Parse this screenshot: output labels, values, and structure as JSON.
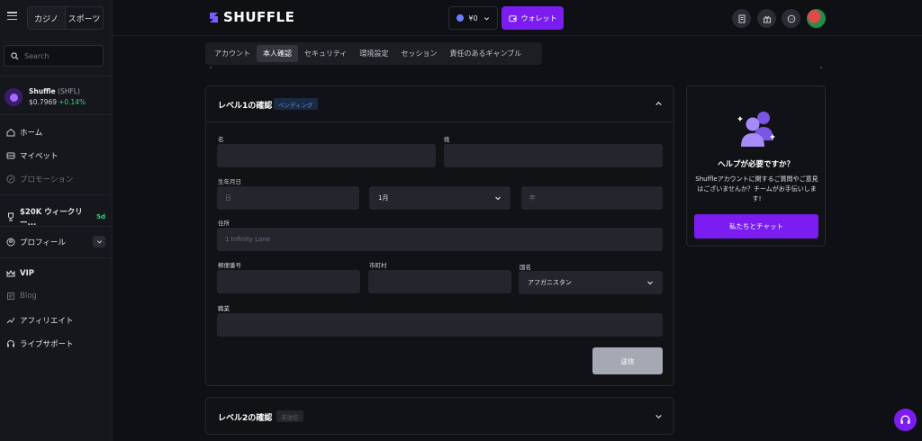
{
  "sidebar": {
    "tabs": [
      "カジノ",
      "スポーツ"
    ],
    "search_placeholder": "Search",
    "token": {
      "name": "Shuffle",
      "symbol": "(SHFL)",
      "price": "$0.7969",
      "change": "+0.14%"
    },
    "items": [
      {
        "label": "ホーム",
        "icon": "home-icon"
      },
      {
        "label": "マイベット",
        "icon": "bets-icon"
      },
      {
        "label": "プロモーション",
        "icon": "promo-icon"
      },
      {
        "label": "$20K ウィークリー...",
        "icon": "trophy-icon",
        "badge": "5d"
      },
      {
        "label": "プロフィール",
        "icon": "user-icon"
      },
      {
        "label": "VIP",
        "icon": "crown-icon"
      },
      {
        "label": "Blog",
        "icon": "blog-icon"
      },
      {
        "label": "アフィリエイト",
        "icon": "affiliate-icon"
      },
      {
        "label": "ライブサポート",
        "icon": "headset-icon"
      }
    ]
  },
  "header": {
    "logo": "SHUFFLE",
    "balance": "¥0",
    "wallet_label": "ウォレット"
  },
  "tabs": [
    "アカウント",
    "本人確認",
    "セキュリティ",
    "環境設定",
    "セッション",
    "責任のあるギャンブル"
  ],
  "level1": {
    "title": "レベル1の確認",
    "status": "ペンディング",
    "labels": {
      "first_name": "名",
      "last_name": "姓",
      "dob": "生年月日",
      "address": "住所",
      "postal": "郵便番号",
      "city": "市町村",
      "country": "国名",
      "occupation": "職業"
    },
    "placeholders": {
      "day": "日",
      "year": "年"
    },
    "month_value": "1月",
    "address_value": "1 Infinity Lane",
    "country_value": "アフガニスタン",
    "submit": "送信"
  },
  "level2": {
    "title": "レベル2の確認",
    "status": "未送信"
  },
  "help": {
    "title": "ヘルプが必要ですか？",
    "text": "Shuffleアカウントに関するご質問やご意見はございませんか？チームがお手伝いします!",
    "button": "私たちとチャット"
  },
  "colors": {
    "accent": "#7b1df0",
    "positive": "#35d07f",
    "pending": "#5b8dd6"
  }
}
